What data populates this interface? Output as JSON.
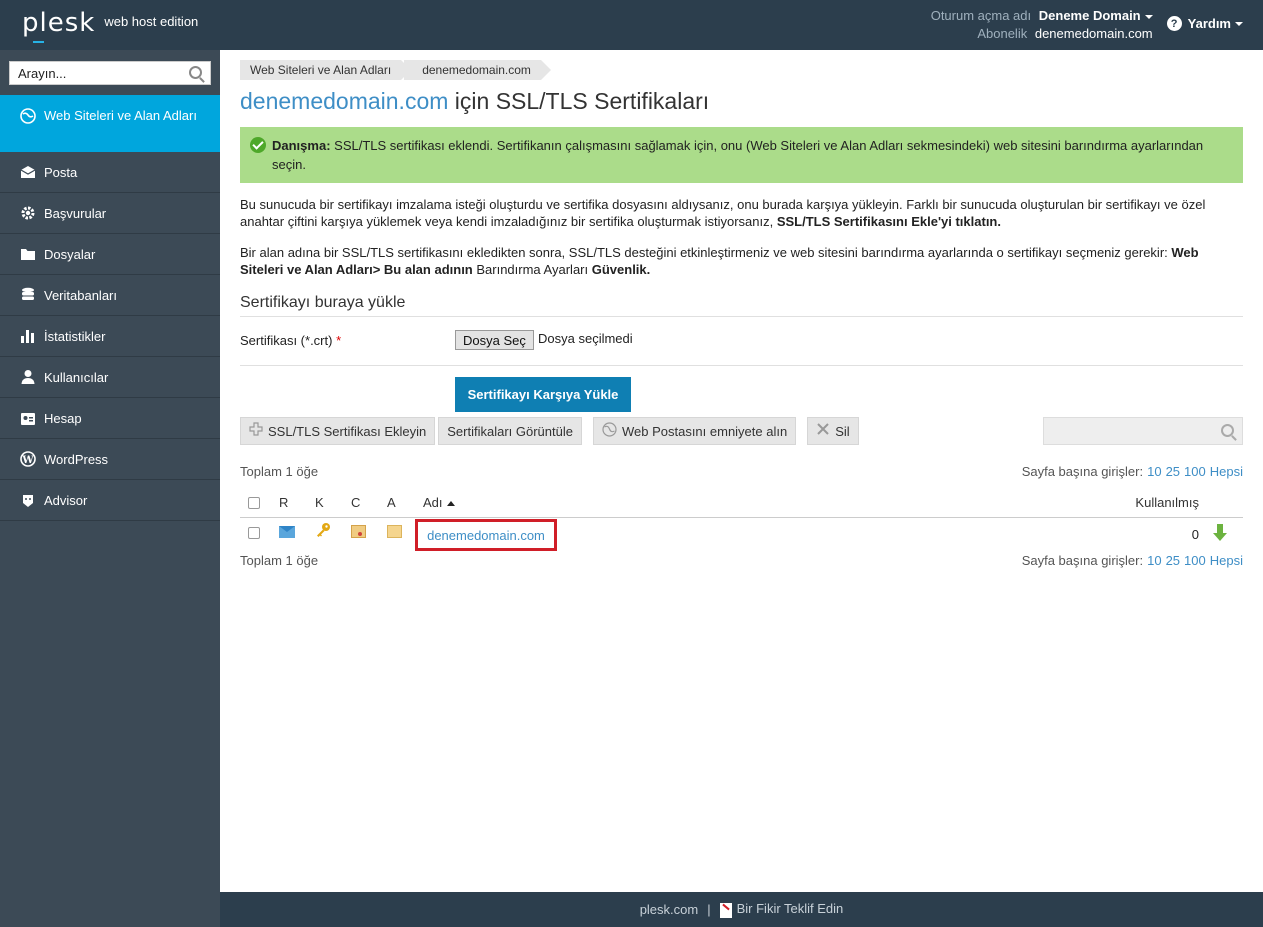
{
  "header": {
    "logo": "plesk",
    "edition": "web host edition",
    "login_label": "Oturum açma adı",
    "login_value": "Deneme Domain",
    "subscription_label": "Abonelik",
    "subscription_value": "denemedomain.com",
    "help_label": "Yardım"
  },
  "sidebar": {
    "search_placeholder": "Arayın...",
    "items": [
      {
        "label": "Web Siteleri ve Alan Adları",
        "icon": "globe-icon",
        "active": true
      },
      {
        "label": "Posta",
        "icon": "mail-icon"
      },
      {
        "label": "Başvurular",
        "icon": "gear-icon"
      },
      {
        "label": "Dosyalar",
        "icon": "folder-icon"
      },
      {
        "label": "Veritabanları",
        "icon": "database-icon"
      },
      {
        "label": "İstatistikler",
        "icon": "bar-chart-icon"
      },
      {
        "label": "Kullanıcılar",
        "icon": "user-icon"
      },
      {
        "label": "Hesap",
        "icon": "account-icon"
      },
      {
        "label": "WordPress",
        "icon": "wordpress-icon"
      },
      {
        "label": "Advisor",
        "icon": "advisor-icon"
      }
    ]
  },
  "breadcrumb": [
    "Web Siteleri ve Alan Adları",
    "denemedomain.com"
  ],
  "title": {
    "domain": "denemedomain.com",
    "rest": " için SSL/TLS Sertifikaları"
  },
  "alert": {
    "label": "Danışma:",
    "text": " SSL/TLS sertifikası eklendi. Sertifikanın çalışmasını sağlamak için, onu (Web Siteleri ve Alan Adları sekmesindeki) web sitesini barındırma ayarlarından seçin."
  },
  "paragraphs": {
    "p1_text": "Bu sunucuda bir sertifikayı imzalama isteği oluşturdu ve sertifika dosyasını aldıysanız, onu burada karşıya yükleyin. Farklı bir sunucuda oluşturulan bir sertifikayı ve özel anahtar çiftini karşıya yüklemek veya kendi imzaladığınız bir sertifika oluşturmak istiyorsanız, ",
    "p1_bold": "SSL/TLS Sertifikasını Ekle'yi tıklatın.",
    "p2_text": "Bir alan adına bir SSL/TLS sertifikasını ekledikten sonra, SSL/TLS desteğini etkinleştirmeniz ve web sitesini barındırma ayarlarında o sertifikayı seçmeniz gerekir: ",
    "p2_bold1": "Web Siteleri ve Alan Adları> Bu alan adının",
    "p2_mid": " Barındırma Ayarları ",
    "p2_bold2": "Güvenlik."
  },
  "upload": {
    "section_title": "Sertifikayı buraya yükle",
    "cert_label": "Sertifikası (*.crt)",
    "required_mark": "*",
    "choose_file": "Dosya Seç",
    "no_file": "Dosya seçilmedi",
    "submit": "Sertifikayı Karşıya Yükle"
  },
  "toolbar": {
    "add_cert": "SSL/TLS Sertifikası Ekleyin",
    "view_certs": "Sertifikaları Görüntüle",
    "secure_webmail": "Web Postasını emniyete alın",
    "delete": "Sil"
  },
  "list": {
    "total": "Toplam 1 öğe",
    "per_page_label": "Sayfa başına girişler:",
    "per_page_options": [
      "10",
      "25",
      "100",
      "Hepsi"
    ],
    "headers": {
      "r": "R",
      "k": "K",
      "c": "C",
      "a": "A",
      "name": "Adı",
      "used": "Kullanılmış"
    },
    "rows": [
      {
        "name": "denemedomain.com",
        "used": "0"
      }
    ]
  },
  "footer": {
    "site": "plesk.com",
    "separator": "|",
    "feedback": "Bir Fikir Teklif Edin"
  }
}
